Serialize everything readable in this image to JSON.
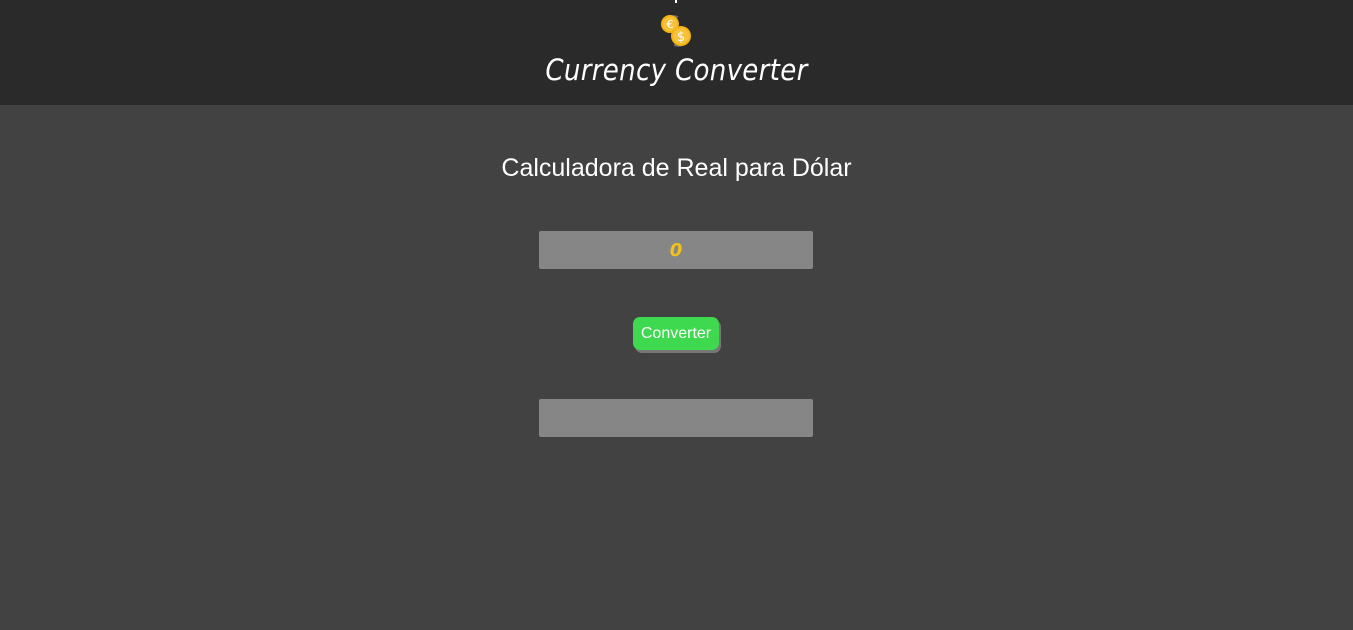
{
  "header": {
    "title": "Currency Converter",
    "logo_icon": "currency-exchange-coins-icon",
    "background": "#2a2a2a"
  },
  "main": {
    "heading": "Calculadora de Real para Dólar",
    "amount_input": {
      "value": "0",
      "placeholder": ""
    },
    "convert_button_label": "Converter",
    "result_field": {
      "value": ""
    },
    "background": "#424242"
  },
  "colors": {
    "button": "#3fd94f",
    "input_background": "#868686",
    "input_text": "#f2c21b",
    "coin": "#f5b314"
  }
}
